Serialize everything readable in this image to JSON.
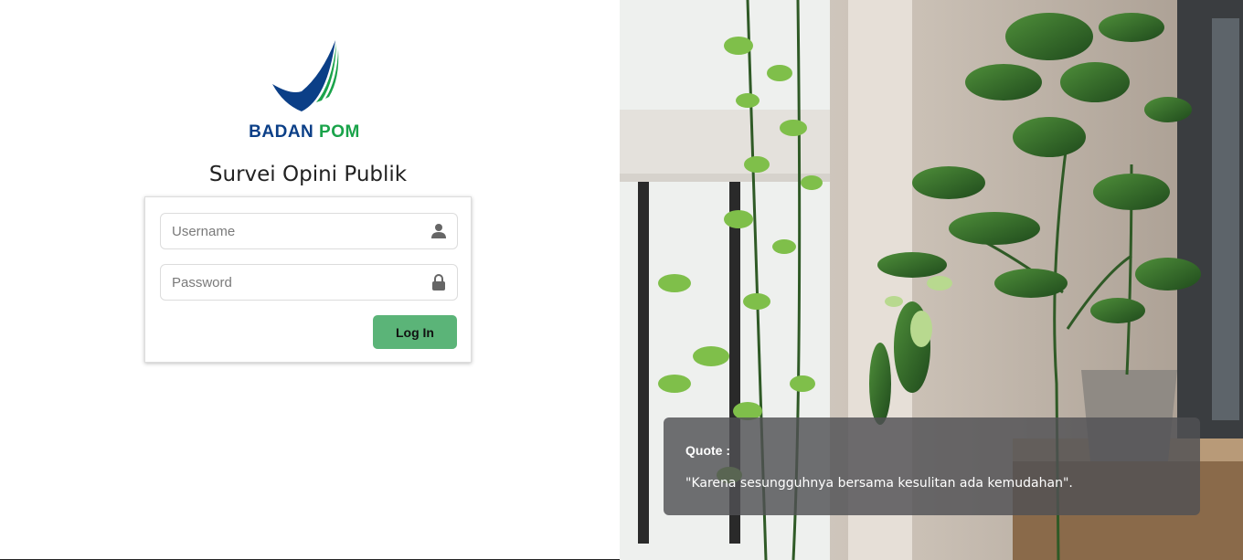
{
  "logo": {
    "word1": "BADAN",
    "word2": "POM"
  },
  "page_title": "Survei Opini Publik",
  "login_form": {
    "username": {
      "placeholder": "Username",
      "value": "",
      "icon": "user-icon"
    },
    "password": {
      "placeholder": "Password",
      "value": "",
      "icon": "lock-icon"
    },
    "submit_label": "Log In"
  },
  "quote": {
    "label": "Quote :",
    "text": "\"Karena sesungguhnya bersama kesulitan ada kemudahan\"."
  },
  "colors": {
    "brand_blue": "#0b3f87",
    "brand_green": "#1aa34a",
    "button_green": "#5bb478"
  }
}
